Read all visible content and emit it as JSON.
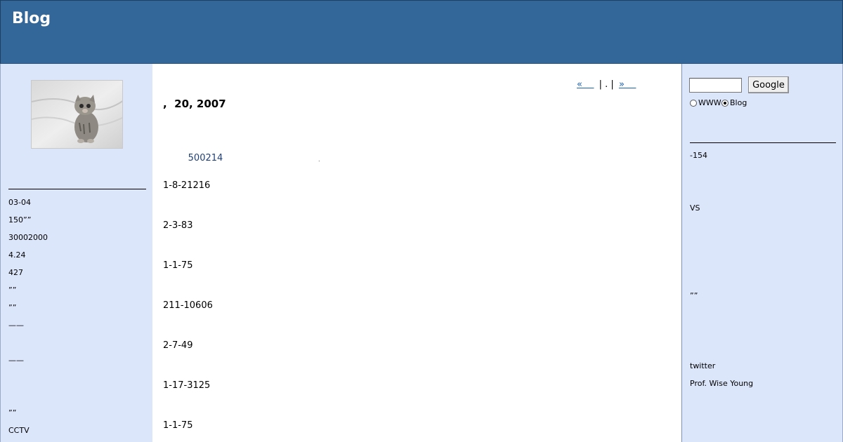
{
  "header": {
    "title": "Blog"
  },
  "left_sidebar": {
    "avatar_alt": "kitten photo",
    "links": [
      "03-04",
      "150””",
      "30002000",
      "4.24",
      "427",
      "””",
      "””",
      "——",
      "——",
      "””",
      "CCTV"
    ]
  },
  "post": {
    "nav": {
      "prev": "«    ",
      "middle": "| . |",
      "next": "»    "
    },
    "date": ",  20, 2007",
    "link": "     500214",
    "dot": ".",
    "lines": [
      "1-8-21216",
      "2-3-83",
      "1-1-75",
      "211-10606",
      "2-7-49",
      "1-17-3125",
      "1-1-75"
    ]
  },
  "right_sidebar": {
    "search": {
      "value": "",
      "button": "Google"
    },
    "radios": [
      {
        "label": "WWW",
        "checked": false
      },
      {
        "label": "Blog",
        "checked": true
      }
    ],
    "links": [
      "-154",
      "VS",
      "””",
      "twitter",
      "Prof. Wise Young"
    ]
  }
}
